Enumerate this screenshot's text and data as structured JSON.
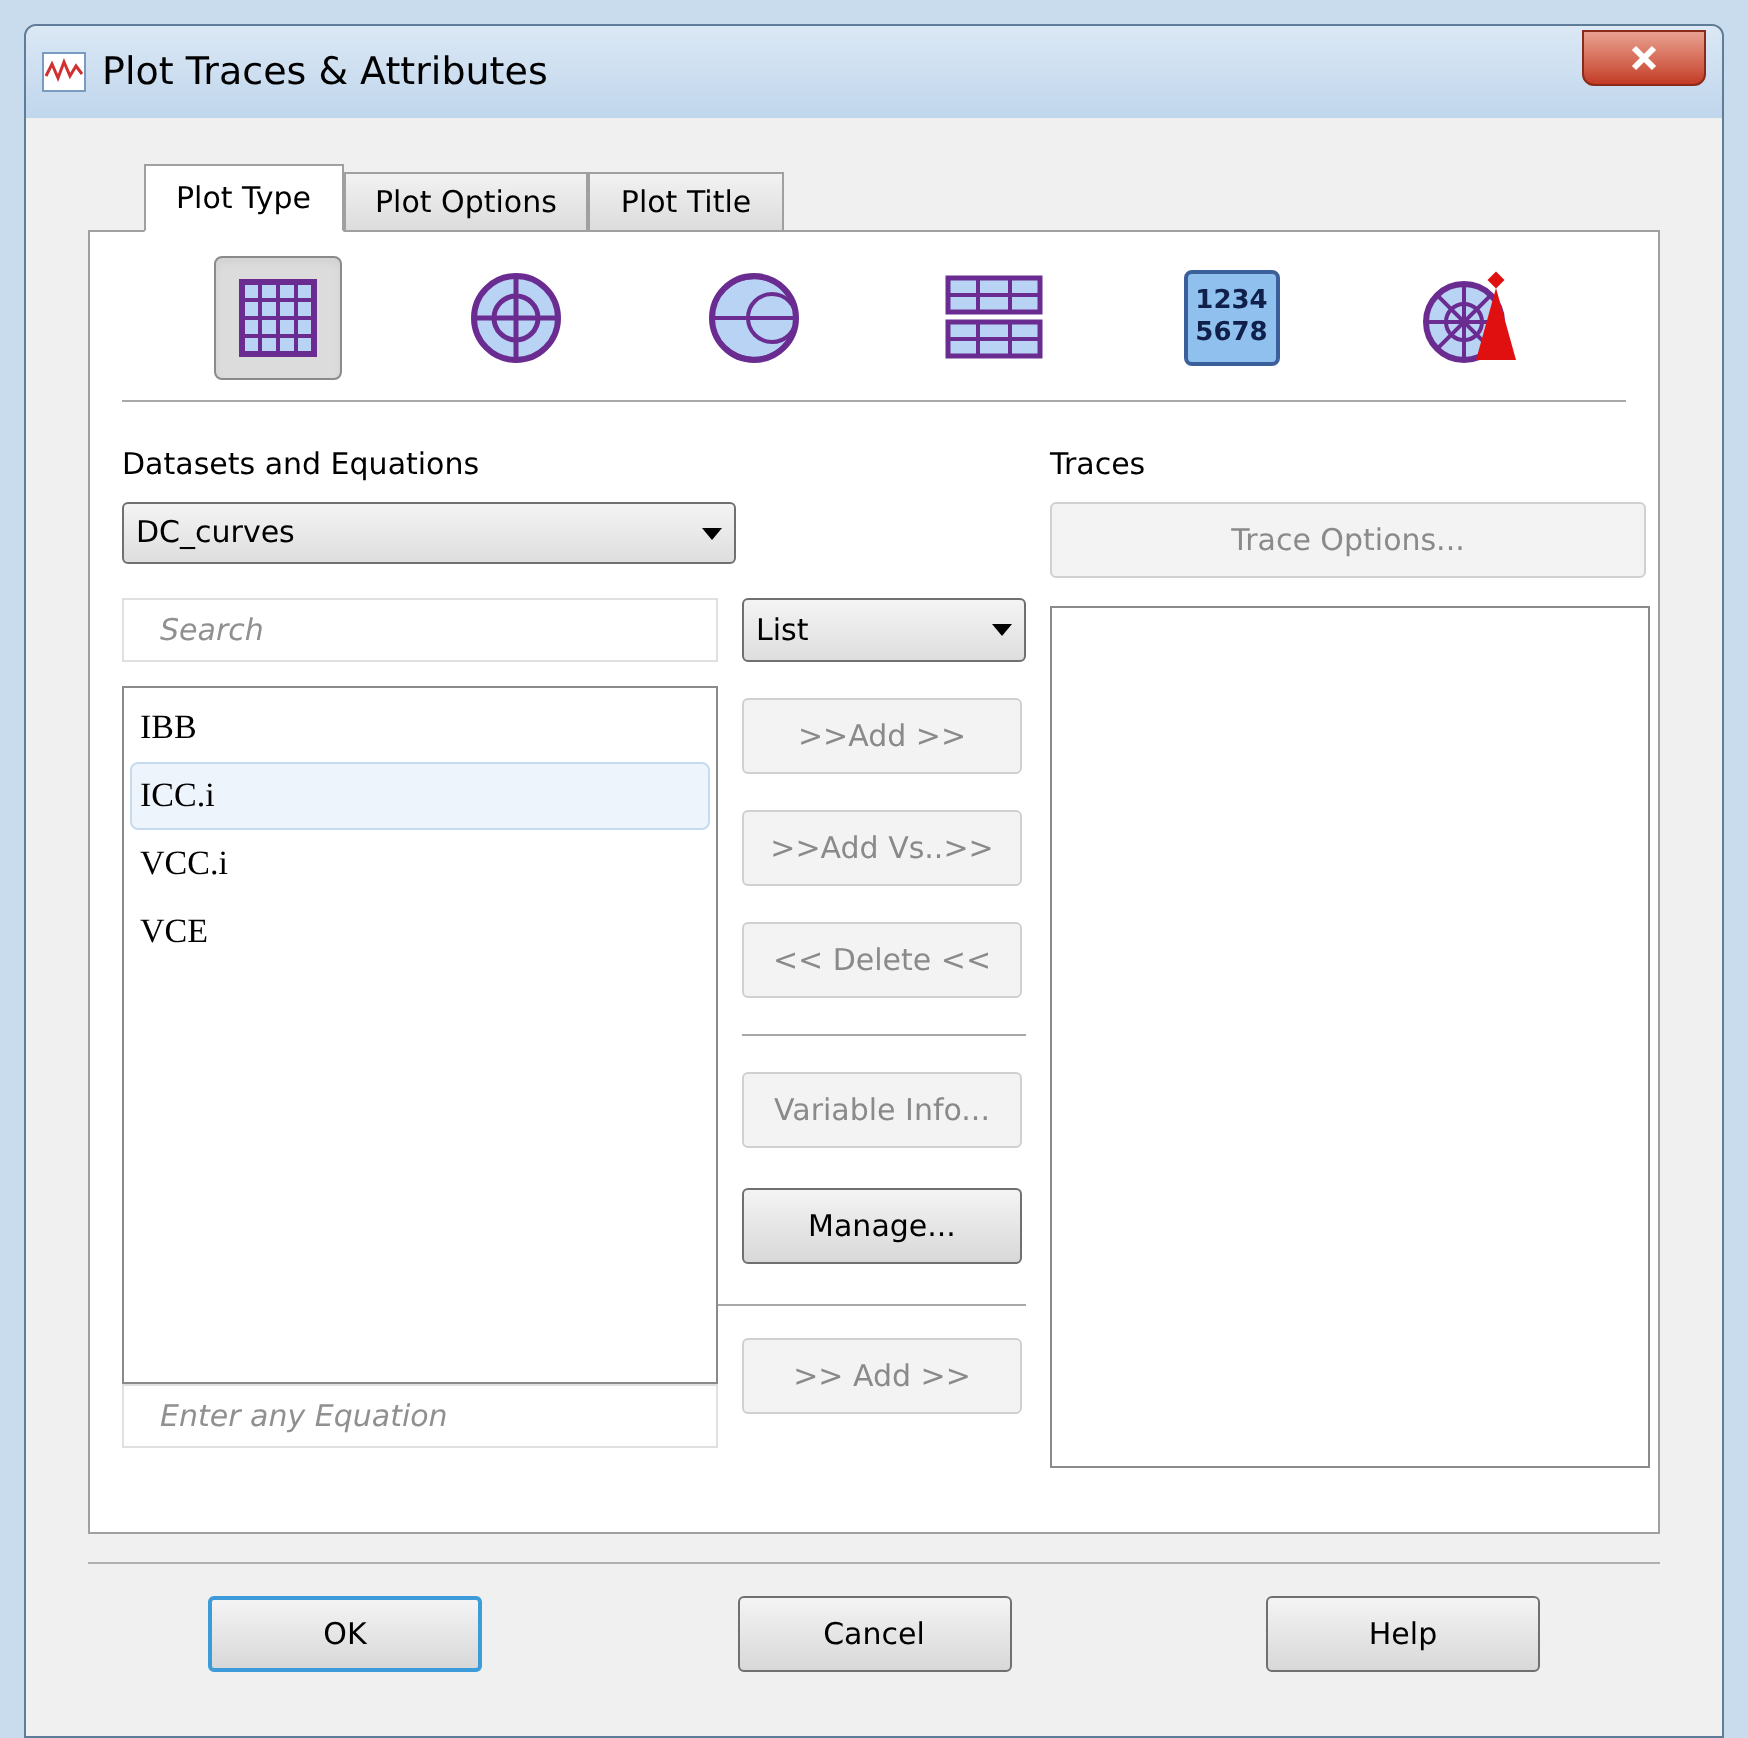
{
  "window": {
    "title": "Plot Traces & Attributes"
  },
  "tabs": [
    {
      "label": "Plot Type",
      "selected": true
    },
    {
      "label": "Plot Options",
      "selected": false
    },
    {
      "label": "Plot Title",
      "selected": false
    }
  ],
  "plot_types": [
    {
      "kind": "rectangular",
      "selected": true
    },
    {
      "kind": "polar",
      "selected": false
    },
    {
      "kind": "smith",
      "selected": false
    },
    {
      "kind": "stacked",
      "selected": false
    },
    {
      "kind": "table",
      "selected": false,
      "lines": [
        "1234",
        "5678"
      ]
    },
    {
      "kind": "antenna",
      "selected": false
    }
  ],
  "datasets": {
    "label": "Datasets and Equations",
    "dataset": "DC_curves",
    "search_placeholder": "Search",
    "view": "List",
    "items": [
      {
        "label": "IBB",
        "selected": false
      },
      {
        "label": "ICC.i",
        "selected": true
      },
      {
        "label": "VCC.i",
        "selected": false
      },
      {
        "label": "VCE",
        "selected": false
      }
    ],
    "equation_placeholder": "Enter any Equation"
  },
  "actions": [
    {
      "label": ">>Add >>",
      "disabled": true
    },
    {
      "label": ">>Add Vs..>>",
      "disabled": true
    },
    {
      "label": "<< Delete <<",
      "disabled": true
    },
    {
      "label": "Variable Info...",
      "disabled": true
    },
    {
      "label": "Manage...",
      "disabled": false
    }
  ],
  "equation_add": {
    "label": ">> Add >>",
    "disabled": true
  },
  "traces": {
    "label": "Traces",
    "options_button": {
      "label": "Trace Options...",
      "disabled": true
    }
  },
  "buttons": [
    {
      "label": "OK",
      "default": true
    },
    {
      "label": "Cancel",
      "default": false
    },
    {
      "label": "Help",
      "default": false
    }
  ]
}
